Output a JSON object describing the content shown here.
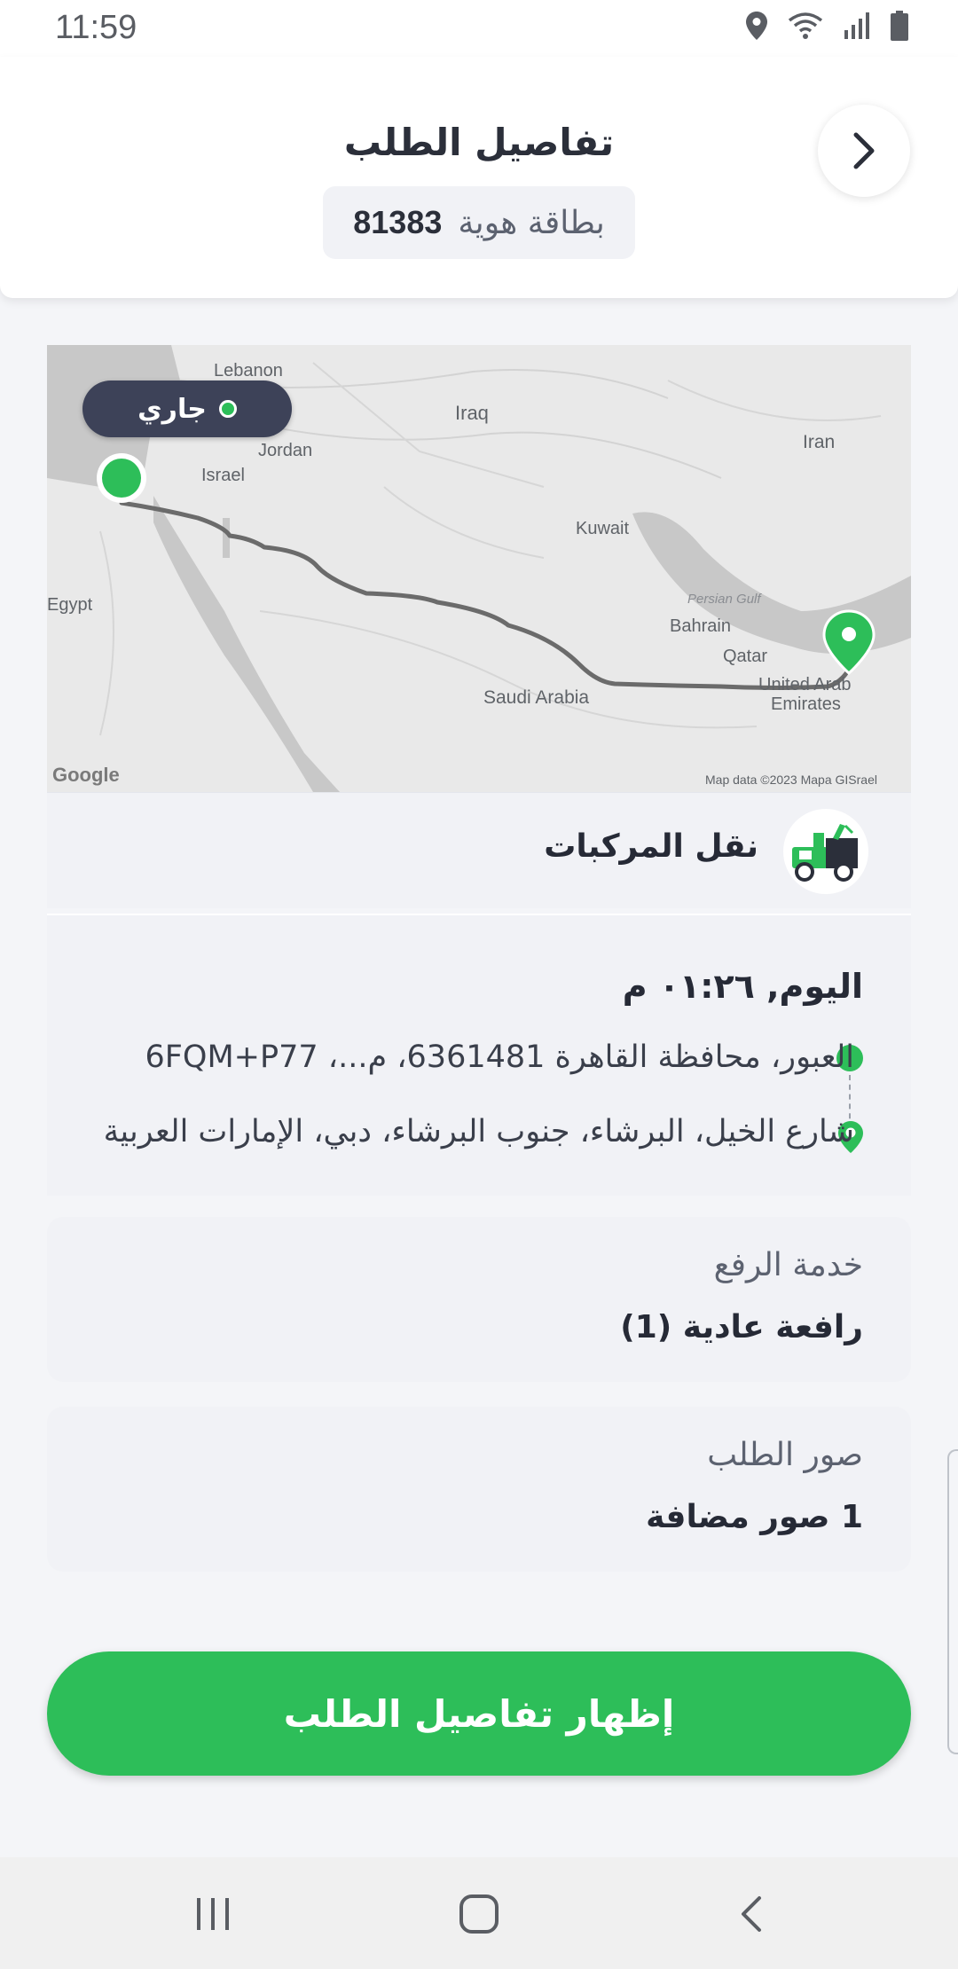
{
  "status_bar": {
    "time": "11:59"
  },
  "header": {
    "title": "تفاصيل الطلب",
    "id_label": "بطاقة هوية",
    "id_number": "81383"
  },
  "map": {
    "status": "جاري",
    "labels": {
      "lebanon": "Lebanon",
      "iraq": "Iraq",
      "jordan": "Jordan",
      "israel": "Israel",
      "iran": "Iran",
      "kuwait": "Kuwait",
      "egypt": "Egypt",
      "persian_gulf": "Persian Gulf",
      "bahrain": "Bahrain",
      "qatar": "Qatar",
      "uae_1": "United Arab",
      "uae_2": "Emirates",
      "saudi": "Saudi Arabia",
      "google": "Google",
      "attribution": "Map data ©2023 Mapa GISrael"
    }
  },
  "service": {
    "name": "نقل المركبات",
    "icon": "tow-truck-icon"
  },
  "route": {
    "date": "اليوم, ٠١:٢٦ م",
    "from": "العبور، محافظة القاهرة 6361481، م...، 6FQM+P77",
    "to": "شارع الخيل، البرشاء، جنوب البرشاء، دبي، الإمارات العربية المتحدة"
  },
  "lift_service": {
    "label": "خدمة الرفع",
    "value": "رافعة عادية (1)"
  },
  "order_photos": {
    "label": "صور الطلب",
    "value": "1 صور مضافة"
  },
  "main_button": {
    "label": "إظهار تفاصيل الطلب"
  },
  "colors": {
    "accent": "#2dbe59",
    "pill": "#3d4258",
    "text": "#2b2f3a"
  }
}
